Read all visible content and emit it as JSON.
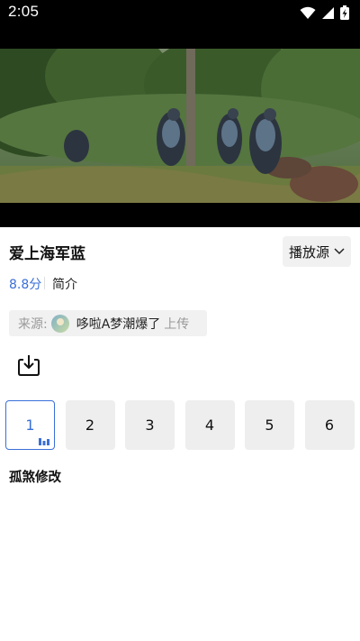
{
  "status_bar": {
    "time": "2:05",
    "icons": [
      "wifi-icon",
      "signal-icon",
      "battery-charging-icon"
    ]
  },
  "video": {
    "content": "video-frame"
  },
  "show": {
    "title": "爱上海军蓝",
    "source_button_label": "播放源",
    "score": "8.8分",
    "intro_label": "简介"
  },
  "uploader": {
    "label": "来源:",
    "name": "哆啦A梦潮爆了",
    "action": "上传"
  },
  "episodes": {
    "items": [
      "1",
      "2",
      "3",
      "4",
      "5",
      "6"
    ],
    "active_index": 0
  },
  "comments": {
    "author": "孤煞修改"
  },
  "colors": {
    "accent": "#3a6fd8",
    "status_bar": "#000000",
    "chip_bg": "#f1f1f1"
  }
}
